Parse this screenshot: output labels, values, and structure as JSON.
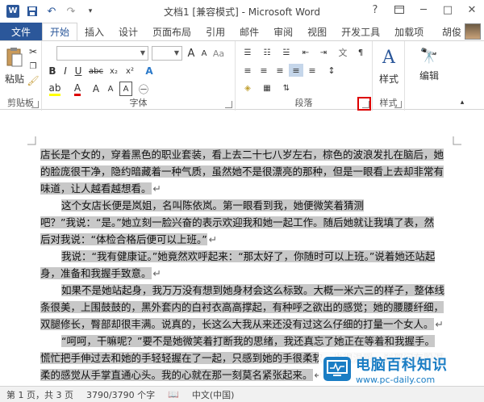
{
  "titlebar": {
    "title": "文档1 [兼容模式] - Microsoft Word",
    "help": "?",
    "min": "─",
    "max": "□",
    "close": "✕"
  },
  "tabs": {
    "file": "文件",
    "items": [
      "开始",
      "插入",
      "设计",
      "页面布局",
      "引用",
      "邮件",
      "审阅",
      "视图",
      "开发工具",
      "加载项"
    ],
    "user": "胡俊"
  },
  "ribbon": {
    "paste": "粘贴",
    "clipboard": "剪贴板",
    "font": "字体",
    "paragraph": "段落",
    "styles_btn": "样式",
    "styles": "样式",
    "edit": "编辑",
    "wen": "wén"
  },
  "document": {
    "lines": [
      "店长是个女的，穿着黑色的职业套装，看上去二十七八岁左右，棕色的波浪发扎在脑后，她",
      "的脸庞很干净，隐约暗藏着一种气质，虽然她不是很漂亮的那种，但是一眼看上去却非常有",
      "味道，让人越看越想看。",
      "这个女店长便是岚姐，名叫陈依岚。第一眼看到我，她便微笑着猜测",
      "吧？”我说：“是。”她立刻一脸兴奋的表示欢迎我和她一起工作。随后她就让我填了表，然",
      "后对我说：“体检合格后便可以上班。”",
      "我说：“我有健康证。”她竟然欢呼起来：“那太好了，你随时可以上班。”说着她还站起",
      "身，准备和我握手致意。",
      "如果不是她站起身，我万万没有想到她身材会这么标致。大概一米六三的样子，整体线",
      "条很美，上围鼓鼓的，黑外套内的白衬衣高高撑起，有种呼之欲出的感觉；她的腰腰纤细，",
      "双腿修长，臀部却很丰满。说真的，长这么大我从来还没有过这么仔细的打量一个女人。",
      "“呵呵，干嘛呢？”要不是她微笑着打断我的思绪，我还真忘了她正在等着和我握手。",
      "慌忙把手伸过去和她的手轻轻握在了一起，只感到她的手很柔软，也很温暖，刹那间有股温",
      "柔的感觉从手掌直通心头。我的心就在那一刻莫名紧张起来。"
    ]
  },
  "statusbar": {
    "page": "第 1 页，共 3 页",
    "words": "3790/3790 个字",
    "lang": "中文(中国)"
  },
  "watermark": {
    "title": "电脑百科知识",
    "url": "www.pc-daily.com"
  },
  "colors": {
    "accent": "#2b579a",
    "highlight": "#d00000"
  }
}
